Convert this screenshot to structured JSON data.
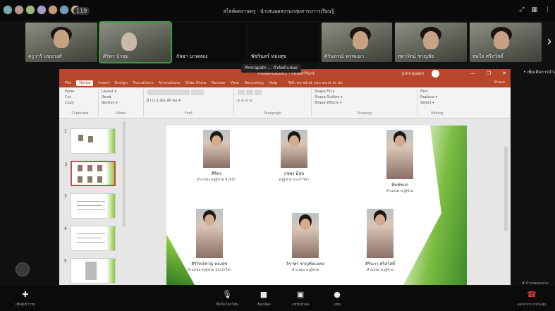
{
  "meeting": {
    "title": "สไลด์ผลงานครู · นำเสนอผลงานกลุ่มสาระการเรียนรู้",
    "participant_count": "119",
    "notice": "Pimrapatn ... กำลังนำเสนอ",
    "side_note": "• เพิ่มเติมการนำเสนอ",
    "side_caption": "# นำเสนอผลงาน"
  },
  "top_icons": [
    "expand-icon",
    "grid-icon",
    "more-icon"
  ],
  "participants": [
    {
      "name": "ครูวารี ปทุมวงศ์",
      "type": "video"
    },
    {
      "name": "ศิริพร บัวชุม",
      "type": "video",
      "active": true
    },
    {
      "name": "กัลยา นาคทอง",
      "type": "dark"
    },
    {
      "name": "พัชรินทร์ ทองสุข",
      "type": "dark"
    },
    {
      "name": "ศิรินภรณ์ พรหมมา",
      "type": "video"
    },
    {
      "name": "สุดารัตน์ ชาญชัย",
      "type": "video"
    },
    {
      "name": "สมใจ ศรีสวัสดิ์",
      "type": "video"
    }
  ],
  "powerpoint": {
    "doc_title": "Presentation1 - PowerPoint",
    "user": "pimrapatn",
    "window_controls": [
      "—",
      "❐",
      "✕"
    ],
    "tabs": [
      "File",
      "Home",
      "Insert",
      "Design",
      "Transitions",
      "Animations",
      "Slide Show",
      "Review",
      "View",
      "Recording",
      "Help"
    ],
    "tell_me": "Tell me what you want to do",
    "share": "Share",
    "ribbon_groups": [
      {
        "label": "Clipboard",
        "rows": [
          "Paste",
          "Cut",
          "Copy"
        ]
      },
      {
        "label": "Slides",
        "rows": [
          "Layout ▾",
          "Reset",
          "Section ▾"
        ]
      },
      {
        "label": "Font",
        "rows": [
          "B I U S abc AV Aa A"
        ]
      },
      {
        "label": "Paragraph",
        "rows": [
          "≡ ≡ ≡ ≡"
        ]
      },
      {
        "label": "Drawing",
        "rows": [
          "Shape Fill ▾",
          "Shape Outline ▾",
          "Shape Effects ▾"
        ]
      },
      {
        "label": "Editing",
        "rows": [
          "Find",
          "Replace ▾",
          "Select ▾"
        ]
      }
    ],
    "thumbnails": [
      "1",
      "2",
      "3",
      "4",
      "5"
    ],
    "slide_people": [
      {
        "name": "ศิริพร",
        "role": "ตำแหน่ง ครูผู้ช่วย หัวหน้า"
      },
      {
        "name": "กชพร มีสุข",
        "role": "ครูผู้ช่วย ประจำวิชา"
      },
      {
        "name": "พิมพ์ชนก",
        "role": "ตำแหน่ง ครูผู้ช่วย"
      },
      {
        "name": "ศิริรัตน์ชาญ ทองสุข",
        "role": "ตำแหน่ง ครูผู้ช่วย ประจำวิชา"
      },
      {
        "name": "จิราพร ชาญชัยมงคล",
        "role": "ตำแหน่ง ครูผู้ช่วย"
      },
      {
        "name": "ศิรินภา ศรีสวัสดิ์",
        "role": "ตำแหน่ง ครูผู้ช่วย"
      }
    ]
  },
  "controls": [
    {
      "label": "เพิ่มผู้เข้าร่วม",
      "icon": "add-person-icon"
    },
    {
      "label": "เปิดไมโครโฟน",
      "icon": "microphone-icon"
    },
    {
      "label": "เปิดกล้อง",
      "icon": "camera-icon"
    },
    {
      "label": "แชร์หน้าจอ",
      "icon": "share-screen-icon"
    },
    {
      "label": "แชท",
      "icon": "chat-icon"
    },
    {
      "label": "ออกจากการประชุม",
      "icon": "leave-call-icon"
    }
  ]
}
